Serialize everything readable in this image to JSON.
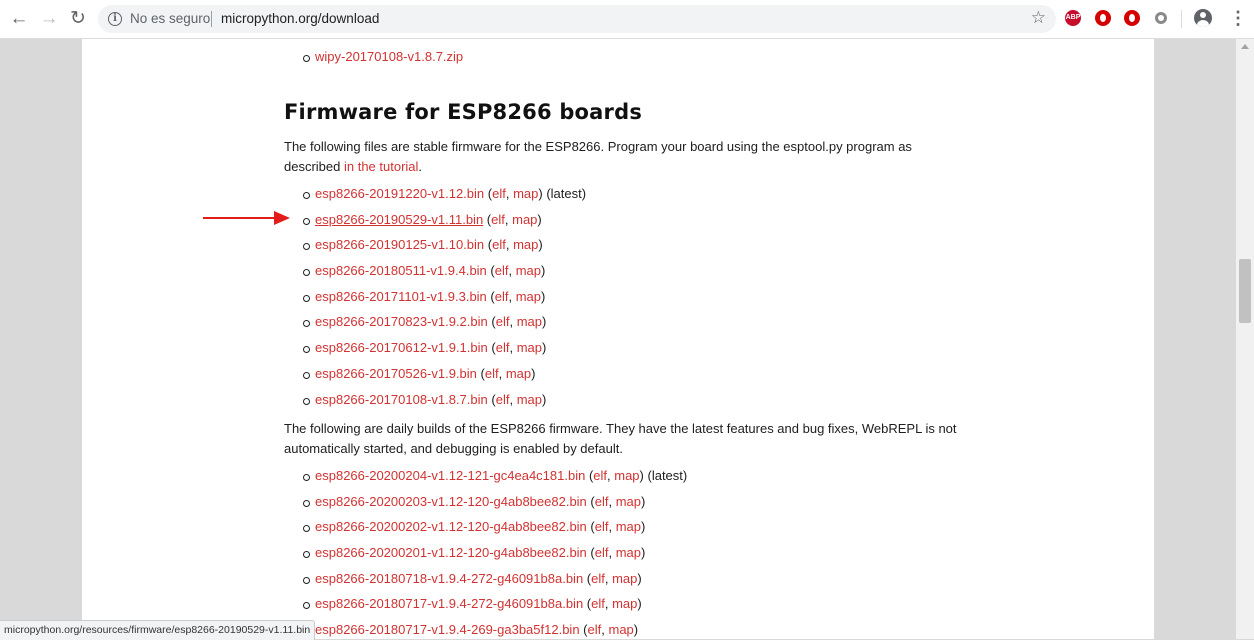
{
  "browser": {
    "security_label": "No es seguro",
    "url": "micropython.org/download",
    "abp_label": "ABP"
  },
  "page": {
    "top_item": {
      "link": "wipy-20170108-v1.8.7.zip"
    },
    "section_title": "Firmware for ESP8266 boards",
    "stable_intro": "The following files are stable firmware for the ESP8266. Program your board using the esptool.py program as described ",
    "tutorial_link": "in the tutorial",
    "stable_intro_end": ".",
    "stable_items": [
      {
        "file": "esp8266-20191220-v1.12.bin",
        "elf": "elf",
        "map": "map",
        "suffix": " (latest)"
      },
      {
        "file": "esp8266-20190529-v1.11.bin",
        "elf": "elf",
        "map": "map",
        "suffix": ""
      },
      {
        "file": "esp8266-20190125-v1.10.bin",
        "elf": "elf",
        "map": "map",
        "suffix": ""
      },
      {
        "file": "esp8266-20180511-v1.9.4.bin",
        "elf": "elf",
        "map": "map",
        "suffix": ""
      },
      {
        "file": "esp8266-20171101-v1.9.3.bin",
        "elf": "elf",
        "map": "map",
        "suffix": ""
      },
      {
        "file": "esp8266-20170823-v1.9.2.bin",
        "elf": "elf",
        "map": "map",
        "suffix": ""
      },
      {
        "file": "esp8266-20170612-v1.9.1.bin",
        "elf": "elf",
        "map": "map",
        "suffix": ""
      },
      {
        "file": "esp8266-20170526-v1.9.bin",
        "elf": "elf",
        "map": "map",
        "suffix": ""
      },
      {
        "file": "esp8266-20170108-v1.8.7.bin",
        "elf": "elf",
        "map": "map",
        "suffix": ""
      }
    ],
    "daily_intro": "The following are daily builds of the ESP8266 firmware. They have the latest features and bug fixes, WebREPL is not automatically started, and debugging is enabled by default.",
    "daily_items": [
      {
        "file": "esp8266-20200204-v1.12-121-gc4ea4c181.bin",
        "elf": "elf",
        "map": "map",
        "suffix": " (latest)"
      },
      {
        "file": "esp8266-20200203-v1.12-120-g4ab8bee82.bin",
        "elf": "elf",
        "map": "map",
        "suffix": ""
      },
      {
        "file": "esp8266-20200202-v1.12-120-g4ab8bee82.bin",
        "elf": "elf",
        "map": "map",
        "suffix": ""
      },
      {
        "file": "esp8266-20200201-v1.12-120-g4ab8bee82.bin",
        "elf": "elf",
        "map": "map",
        "suffix": ""
      },
      {
        "file": "esp8266-20180718-v1.9.4-272-g46091b8a.bin",
        "elf": "elf",
        "map": "map",
        "suffix": ""
      },
      {
        "file": "esp8266-20180717-v1.9.4-272-g46091b8a.bin",
        "elf": "elf",
        "map": "map",
        "suffix": ""
      },
      {
        "file": "esp8266-20180717-v1.9.4-269-ga3ba5f12.bin",
        "elf": "elf",
        "map": "map",
        "suffix": ""
      }
    ]
  },
  "status_bar": {
    "text": "micropython.org/resources/firmware/esp8266-20190529-v1.11.bin"
  },
  "colors": {
    "link": "#d23232",
    "annotation_arrow": "#e31b1b"
  }
}
